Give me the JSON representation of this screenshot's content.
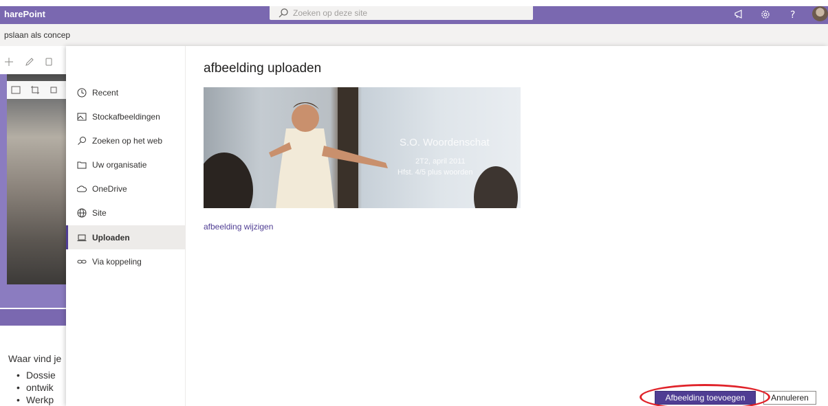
{
  "app": {
    "brand": "harePoint"
  },
  "search": {
    "placeholder": "Zoeken op deze site"
  },
  "cmdbar": {
    "save_label": "pslaan als concep"
  },
  "panel": {
    "title": "afbeelding uploaden",
    "nav": [
      {
        "label": "Recent",
        "icon": "clock-icon"
      },
      {
        "label": "Stockafbeeldingen",
        "icon": "stock-images-icon"
      },
      {
        "label": "Zoeken op het web",
        "icon": "search-icon"
      },
      {
        "label": "Uw organisatie",
        "icon": "folder-icon"
      },
      {
        "label": "OneDrive",
        "icon": "cloud-icon"
      },
      {
        "label": "Site",
        "icon": "globe-icon"
      },
      {
        "label": "Uploaden",
        "icon": "laptop-icon",
        "active": true
      },
      {
        "label": "Via koppeling",
        "icon": "link-icon"
      }
    ],
    "preview": {
      "slide_title": "S.O. Woordenschat",
      "slide_line1": "2T2, april 2011",
      "slide_line2": "Hfst. 4/5 plus woorden"
    },
    "change_link": "afbeelding wijzigen",
    "add_button": "Afbeelding toevoegen",
    "cancel_button": "Annuleren"
  },
  "background": {
    "text": "Waar vind je",
    "list": [
      "Dossie",
      "ontwik",
      "Werkp"
    ]
  },
  "colors": {
    "accent": "#4f3d93",
    "suitebar": "#7a68b0",
    "highlight": "#e0232a"
  }
}
